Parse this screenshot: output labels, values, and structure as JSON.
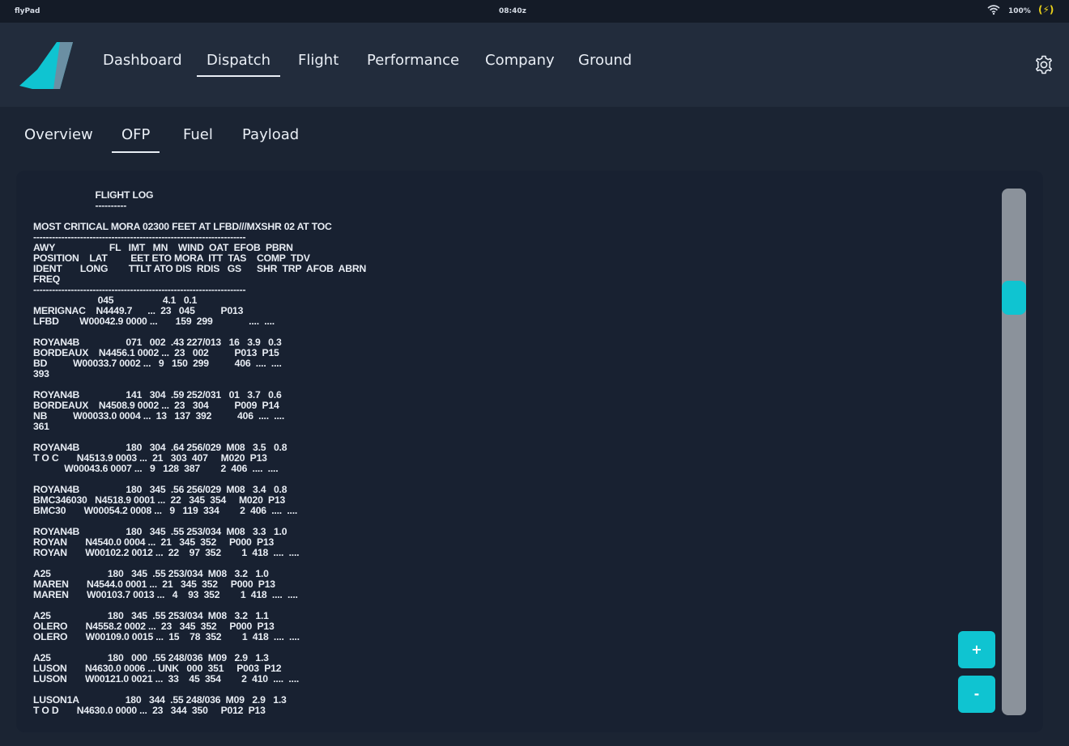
{
  "status_bar": {
    "app_name": "flyPad",
    "time": "08:40z",
    "battery": "100%",
    "charging_icon": "(⚡)"
  },
  "nav": {
    "items": [
      "Dashboard",
      "Dispatch",
      "Flight",
      "Performance",
      "Company",
      "Ground"
    ],
    "active": "Dispatch",
    "logo_icon": "tail-logo-icon",
    "settings_icon": "gear-icon"
  },
  "subtabs": {
    "items": [
      "Overview",
      "OFP",
      "Fuel",
      "Payload"
    ],
    "active": "OFP"
  },
  "ofp": {
    "text": "                        FLIGHT LOG\n                        ----------\n\nMOST CRITICAL MORA 02300 FEET AT LFBD///MXSHR 02 AT TOC\n--------------------------------------------------------------------\nAWY                     FL   IMT   MN    WIND  OAT  EFOB  PBRN\nPOSITION    LAT         EET ETO MORA  ITT  TAS    COMP  TDV\nIDENT       LONG        TTLT ATO DIS  RDIS   GS      SHR  TRP  AFOB  ABRN\nFREQ\n--------------------------------------------------------------------\n                         045                   4.1   0.1\nMERIGNAC    N4449.7      ...  23   045          P013\nLFBD        W00042.9 0000 ...       159  299              ....  ....\n\nROYAN4B                  071   002  .43 227/013   16   3.9   0.3\nBORDEAUX    N4456.1 0002 ...  23   002          P013  P15\nBD          W00033.7 0002 ...   9   150  299          406  ....  ....\n393\n\nROYAN4B                  141   304  .59 252/031   01   3.7   0.6\nBORDEAUX    N4508.9 0002 ...  23   304          P009  P14\nNB          W00033.0 0004 ...  13   137  392          406  ....  ....\n361\n\nROYAN4B                  180   304  .64 256/029  M08   3.5   0.8\nT O C       N4513.9 0003 ...  21   303  407     M020  P13\n            W00043.6 0007 ...   9   128  387        2  406  ....  ....\n\nROYAN4B                  180   345  .56 256/029  M08   3.4   0.8\nBMC346030   N4518.9 0001 ...  22   345  354     M020  P13\nBMC30       W00054.2 0008 ...   9   119  334        2  406  ....  ....\n\nROYAN4B                  180   345  .55 253/034  M08   3.3   1.0\nROYAN       N4540.0 0004 ...  21   345  352     P000  P13\nROYAN       W00102.2 0012 ...  22    97  352        1  418  ....  ....\n\nA25                      180   345  .55 253/034  M08   3.2   1.0\nMAREN       N4544.0 0001 ...  21   345  352     P000  P13\nMAREN       W00103.7 0013 ...   4    93  352        1  418  ....  ....\n\nA25                      180   345  .55 253/034  M08   3.2   1.1\nOLERO       N4558.2 0002 ...  23   345  352     P000  P13\nOLERO       W00109.0 0015 ...  15    78  352        1  418  ....  ....\n\nA25                      180   000  .55 248/036  M09   2.9   1.3\nLUSON       N4630.0 0006 ... UNK   000  351     P003  P12\nLUSON       W00121.0 0021 ...  33    45  354        2  410  ....  ....\n\nLUSON1A                  180   344  .55 248/036  M09   2.9   1.3\nT O D       N4630.0 0000 ...  23   344  350     P012  P13"
  },
  "controls": {
    "zoom_in_label": "+",
    "zoom_out_label": "-"
  },
  "colors": {
    "background": "#1b2433",
    "navbar": "#222c3c",
    "panel": "#182131",
    "accent": "#0fc4d1",
    "scroll_track": "#8b929b"
  }
}
